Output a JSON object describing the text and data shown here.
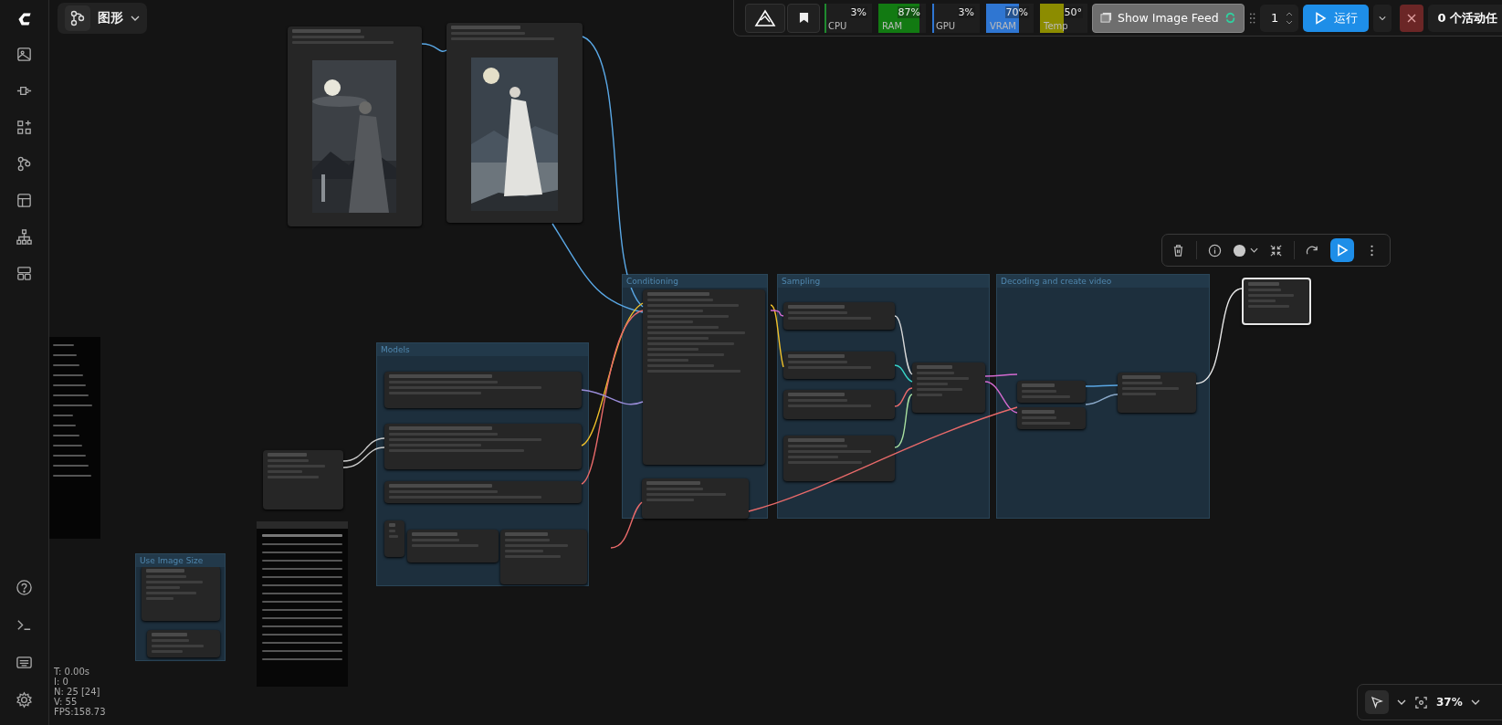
{
  "workflow_menu": {
    "label": "图形"
  },
  "monitor": [
    {
      "label": "CPU",
      "value": "3%",
      "level": 0.03,
      "color": "#1f8a2e"
    },
    {
      "label": "RAM",
      "value": "87%",
      "level": 0.87,
      "color": "#127a12"
    },
    {
      "label": "GPU",
      "value": "3%",
      "level": 0.03,
      "color": "#2f76d2"
    },
    {
      "label": "VRAM",
      "value": "70%",
      "level": 0.7,
      "color": "#2f76d2"
    },
    {
      "label": "Temp",
      "value": "50°",
      "level": 0.5,
      "color": "#8c8c00"
    }
  ],
  "image_feed_button": "Show Image Feed",
  "batch_count": "1",
  "run_button": "运行",
  "queue_status": "0 个活动任",
  "groups": [
    {
      "title": "Models"
    },
    {
      "title": "Conditioning"
    },
    {
      "title": "Sampling"
    },
    {
      "title": "Decoding and create video"
    },
    {
      "title": "Use Image Size"
    }
  ],
  "stats": [
    "T: 0.00s",
    "I: 0",
    "N: 25 [24]",
    "V: 55",
    "FPS:158.73"
  ],
  "zoom_level": "37%"
}
